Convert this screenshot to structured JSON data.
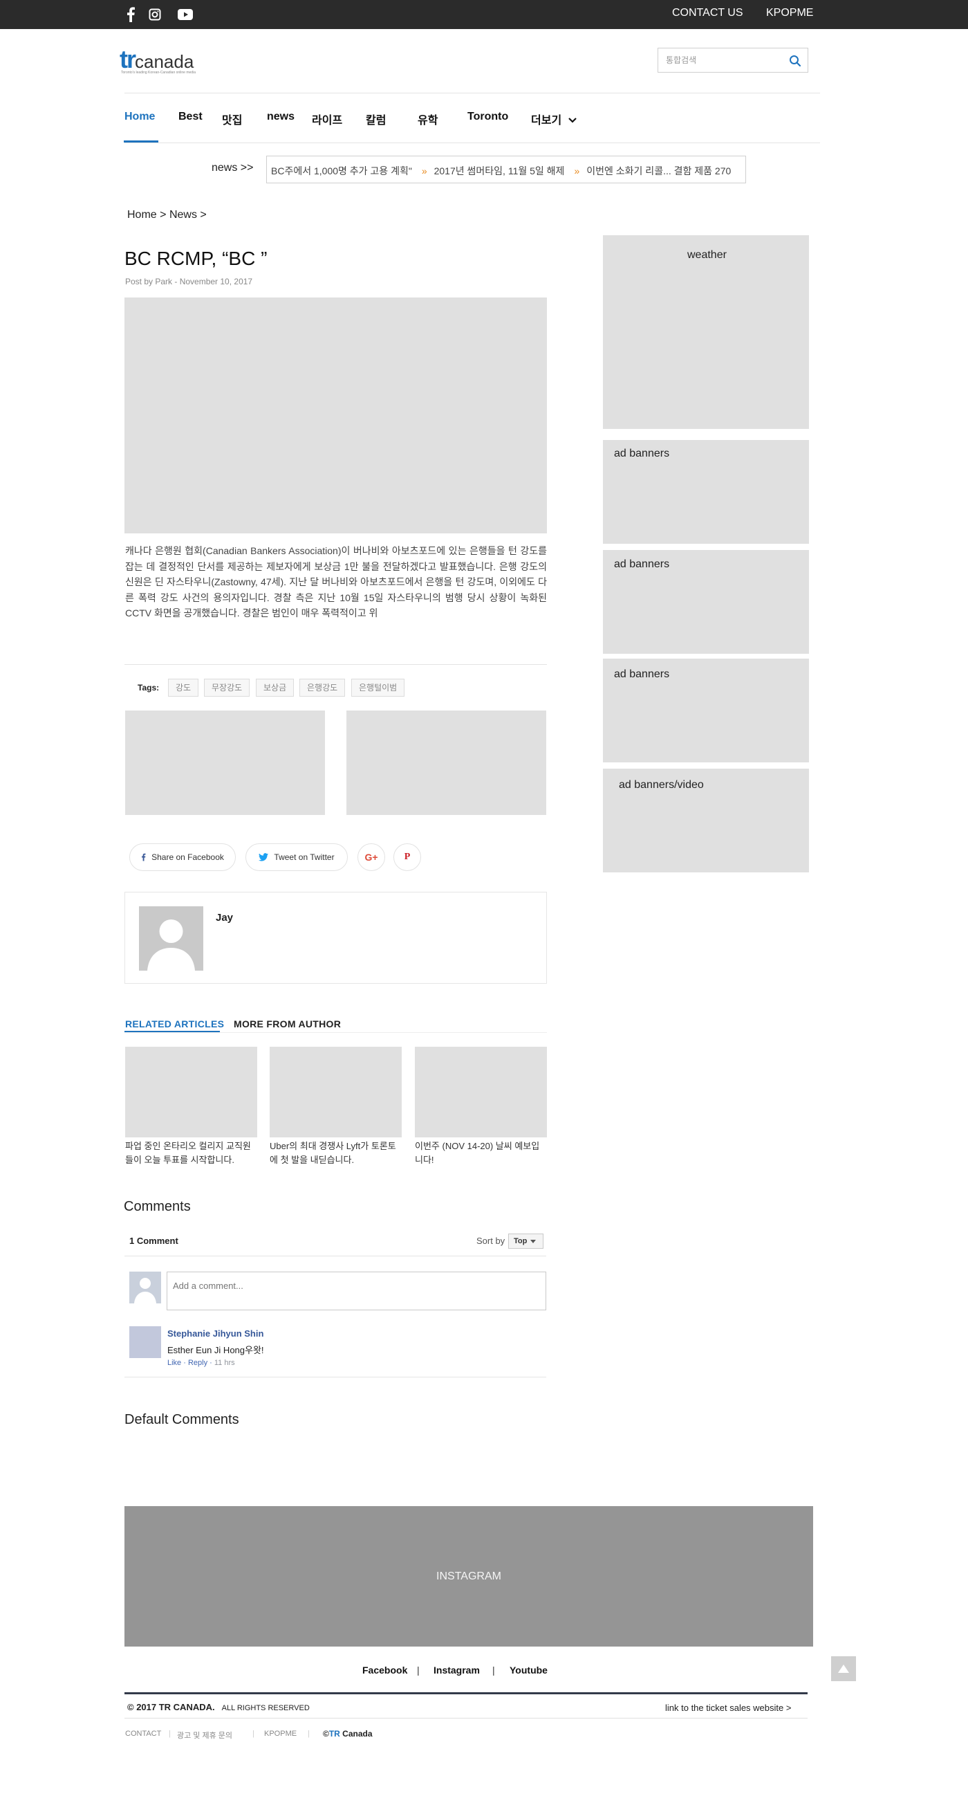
{
  "topbar": {
    "social": [
      "facebook-icon",
      "instagram-icon",
      "youtube-icon"
    ],
    "links": [
      "CONTACT US",
      "KPOPME"
    ]
  },
  "header": {
    "logo_tr": "tr",
    "logo_canada": "canada",
    "logo_tagline": "Toronto's leading Korean-Canadian online media",
    "search_placeholder": "통합검색"
  },
  "nav": {
    "items": [
      "Home",
      "Best",
      "맛집",
      "news",
      "라이프",
      "칼럼",
      "유학",
      "Toronto",
      "더보기"
    ],
    "active": "Home"
  },
  "ticker": {
    "label": "news >>",
    "items": [
      "BC주에서 1,000명 추가 고용 계획\"",
      "2017년 썸머타임, 11월 5일 해제",
      "이번엔 소화기 리콜... 결함 제품 270"
    ]
  },
  "breadcrumb": {
    "home": "Home",
    "section": "News",
    "sep": ">"
  },
  "article": {
    "title": "BC RCMP, “BC ”",
    "byline": "Post by Park - November 10, 2017",
    "body": "캐나다 은행원 협회(Canadian Bankers Association)이 버나비와 아보츠포드에 있는 은행들을 턴 강도를 잡는 데 결정적인 단서를 제공하는 제보자에게 보상금 1만 불을 전달하겠다고 발표했습니다. 은행 강도의 신원은 딘 자스타우니(Zastowny, 47세). 지난 달 버나비와 아보츠포드에서 은행을 턴 강도며, 이외에도 다른 폭력 강도 사건의 용의자입니다.  경찰 측은 지난 10월 15일 자스타우니의 범행 당시 상황이 녹화된 CCTV 화면을 공개했습니다. 경찰은 범인이 매우 폭력적이고 위",
    "tags_label": "Tags:",
    "tags": [
      "강도",
      "무장강도",
      "보상금",
      "은행강도",
      "은행털이범"
    ]
  },
  "share": {
    "facebook": "Share on Facebook",
    "twitter": "Tweet on Twitter",
    "google": "G+",
    "pinterest": "P"
  },
  "author": {
    "name": "Jay"
  },
  "related": {
    "tabs": [
      "RELATED ARTICLES",
      "MORE FROM AUTHOR"
    ],
    "articles": [
      "파업 중인 온타리오 컬리지 교직원들이 오늘 투표를 시작합니다.",
      "Uber의 최대 경쟁사 Lyft가 토론토에 첫 발을 내딛습니다.",
      "이번주 (NOV 14-20) 날씨 예보입니다!"
    ]
  },
  "comments": {
    "heading": "Comments",
    "count": "1 Comment",
    "sort_label": "Sort by",
    "sort_value": "Top",
    "placeholder": "Add a comment...",
    "entry": {
      "author": "Stephanie Jihyun Shin",
      "text": "Esther Eun Ji Hong우왓!",
      "like": "Like",
      "reply": "Reply",
      "time": "11 hrs"
    },
    "default_heading": "Default Comments"
  },
  "sidebar": {
    "boxes": [
      "weather",
      "ad banners",
      "ad banners",
      "ad banners",
      "ad banners/video"
    ]
  },
  "instagram": {
    "label": "INSTAGRAM"
  },
  "footer": {
    "links": [
      "Facebook",
      "Instagram",
      "Youtube"
    ],
    "sep": "|",
    "copyright": "© 2017 TR CANADA.",
    "rights": "ALL RIGHTS RESERVED",
    "ticket_link": "link to the ticket sales website >",
    "small_links": [
      "CONTACT",
      "광고 및 제휴 문의",
      "KPOPME"
    ],
    "brand_prefix": "©",
    "brand_tr": "TR",
    "brand_rest": " Canada"
  },
  "colors": {
    "accent": "#1e73be",
    "topbar": "#2b2b2b",
    "placeholder_box": "#e0e0e0",
    "instagram_box": "#959595"
  }
}
